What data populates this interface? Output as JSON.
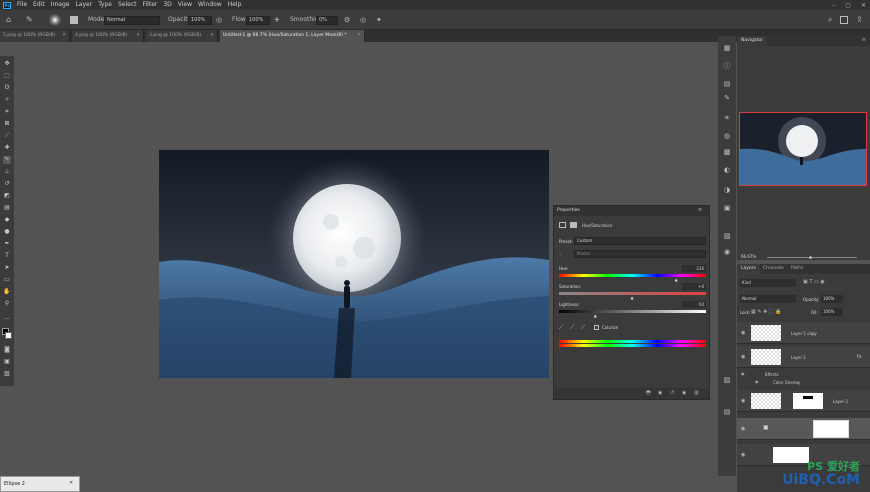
{
  "app": {
    "logo": "Ps"
  },
  "menus": [
    "File",
    "Edit",
    "Image",
    "Layer",
    "Type",
    "Select",
    "Filter",
    "3D",
    "View",
    "Window",
    "Help"
  ],
  "window_controls": [
    "–",
    "▢",
    "✕"
  ],
  "options": {
    "mode_label": "Mode:",
    "mode_value": "Normal",
    "opacity_label": "Opacity:",
    "opacity_value": "100%",
    "flow_label": "Flow:",
    "flow_value": "100%",
    "smoothing_label": "Smoothing:",
    "smoothing_value": "0%"
  },
  "tabs": [
    {
      "label": "5.png @ 100% (RGB/8)",
      "active": false
    },
    {
      "label": "4.png @ 100% (RGB/8)",
      "active": false
    },
    {
      "label": "3.png @ 100% (RGB/8)",
      "active": false
    },
    {
      "label": "Untitled-1 @ 66.7% (Hue/Saturation 1, Layer Mask/8) *",
      "active": true
    }
  ],
  "navigator": {
    "title": "Navigator",
    "zoom": "66.67%"
  },
  "properties": {
    "title": "Properties",
    "adjustment_name": "Hue/Saturation",
    "preset_label": "Preset:",
    "preset_value": "Custom",
    "channel_value": "Master",
    "hue_label": "Hue:",
    "hue_value": "216",
    "hue_pos": 0.8,
    "saturation_label": "Saturation:",
    "saturation_value": "+0",
    "saturation_pos": 0.5,
    "lightness_label": "Lightness:",
    "lightness_value": "-50",
    "lightness_pos": 0.25,
    "colorize_label": "Colorize"
  },
  "layers": {
    "tabs": [
      "Layers",
      "Channels",
      "Paths"
    ],
    "kind_value": "Kind",
    "blend_value": "Normal",
    "opacity_label": "Opacity:",
    "opacity_value": "100%",
    "lock_label": "Lock:",
    "fill_label": "Fill:",
    "fill_value": "100%",
    "rows": [
      {
        "name": "Layer 1 copy"
      },
      {
        "name": "Layer 1"
      },
      {
        "name": "Effects"
      },
      {
        "name": "Color Overlay"
      },
      {
        "name": "Layer 2"
      },
      {
        "name": ""
      },
      {
        "name": ""
      }
    ]
  },
  "status": {
    "label": "Ellipse 2"
  },
  "watermark": {
    "line1": "PS 爱好者",
    "line2": "UiBQ.CoM"
  }
}
